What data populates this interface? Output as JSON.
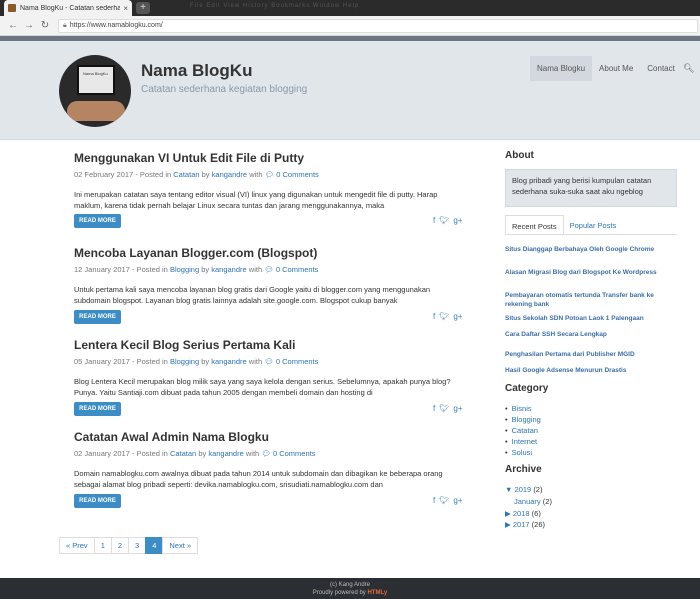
{
  "browser": {
    "tab_title": "Nama BlogKu - Catatan sederhana",
    "tab_close": "×",
    "new_tab": "+",
    "menu_ghost": "File  Edit  View  History  Bookmarks  Window  Help",
    "url": "https://www.namablogku.com/"
  },
  "header": {
    "site_title": "Nama BlogKu",
    "site_desc": "Catatan sederhana kegiatan blogging",
    "avatar_text": "Nama BlogKu",
    "nav": [
      "Nama Blogku",
      "About Me",
      "Contact"
    ]
  },
  "posts": [
    {
      "title": "Menggunakan VI Untuk Edit File di Putty",
      "date": "02 February 2017",
      "category": "Catatan",
      "author": "kangandre",
      "comments": "0 Comments",
      "excerpt": "Ini merupakan catatan saya tentang editor visual (VI) linux yang digunakan untuk mengedit file di putty. Harap maklum, karena tidak pernah belajar Linux secara tuntas dan jarang menggunakannya, maka"
    },
    {
      "title": "Mencoba Layanan Blogger.com (Blogspot)",
      "date": "12 January 2017",
      "category": "Blogging",
      "author": "kangandre",
      "comments": "0 Comments",
      "excerpt": "Untuk pertama kali saya mencoba layanan blog gratis dari Google yaitu di blogger.com yang menggunakan subdomain blogspot. Layanan blog gratis lainnya adalah site.google.com. Blogspot cukup banyak"
    },
    {
      "title": "Lentera Kecil Blog Serius Pertama Kali",
      "date": "05 January 2017",
      "category": "Blogging",
      "author": "kangandre",
      "comments": "0 Comments",
      "excerpt": "Blog Lentera Kecil merupakan blog milik saya yang saya kelola dengan serius. Sebelumnya, apakah punya blog? Punya. Yaitu Santiaji.com dibuat pada tahun 2005 dengan membeli domain dan hosting di"
    },
    {
      "title": "Catatan Awal Admin Nama Blogku",
      "date": "02 January 2017",
      "category": "Catatan",
      "author": "kangandre",
      "comments": "0 Comments",
      "excerpt": "Domain namablogku.com awalnya dibuat pada tahun 2014 untuk subdomain dan dibagikan ke beberapa orang sebagai alamat blog pribadi seperti: devika.namablogku.com, srisudiati.namablogku.com dan"
    }
  ],
  "post_labels": {
    "posted_in": "- Posted in",
    "by": "by",
    "with": "with",
    "read_more": "READ MORE"
  },
  "pagination": [
    "« Prev",
    "1",
    "2",
    "3",
    "4",
    "Next »"
  ],
  "sidebar": {
    "about_heading": "About",
    "about_text": "Blog pribadi yang berisi kumpulan catatan sederhana suka-suka saat aku ngeblog",
    "tab_recent": "Recent Posts",
    "tab_popular": "Popular Posts",
    "recent_posts": [
      "Situs Dianggap Berbahaya Oleh Google Chrome",
      "Alasan Migrasi Blog dari Blogspot Ke Wordpress",
      "Pembayaran otomatis tertunda Transfer bank ke rekening bank",
      "Situs Sekolah SDN Potoan Laok 1 Palengaan",
      "Cara Daftar SSH Secara Lengkap",
      "Penghasilan Pertama dari Publisher MGID",
      "Hasil Google Adsense Menurun Drastis"
    ],
    "category_heading": "Category",
    "categories": [
      "Bisnis",
      "Blogging",
      "Catatan",
      "Internet",
      "Solusi"
    ],
    "archive_heading": "Archive",
    "archive": [
      {
        "toggle": "▼",
        "year": "2019",
        "count": "(2)"
      },
      {
        "toggle": "",
        "year": "January",
        "count": "(2)"
      },
      {
        "toggle": "▶",
        "year": "2018",
        "count": "(6)"
      },
      {
        "toggle": "▶",
        "year": "2017",
        "count": "(26)"
      }
    ]
  },
  "footer": {
    "copyright": "(c) Kang Andre",
    "powered": "Proudly powered by",
    "brand": "HTMLy"
  }
}
